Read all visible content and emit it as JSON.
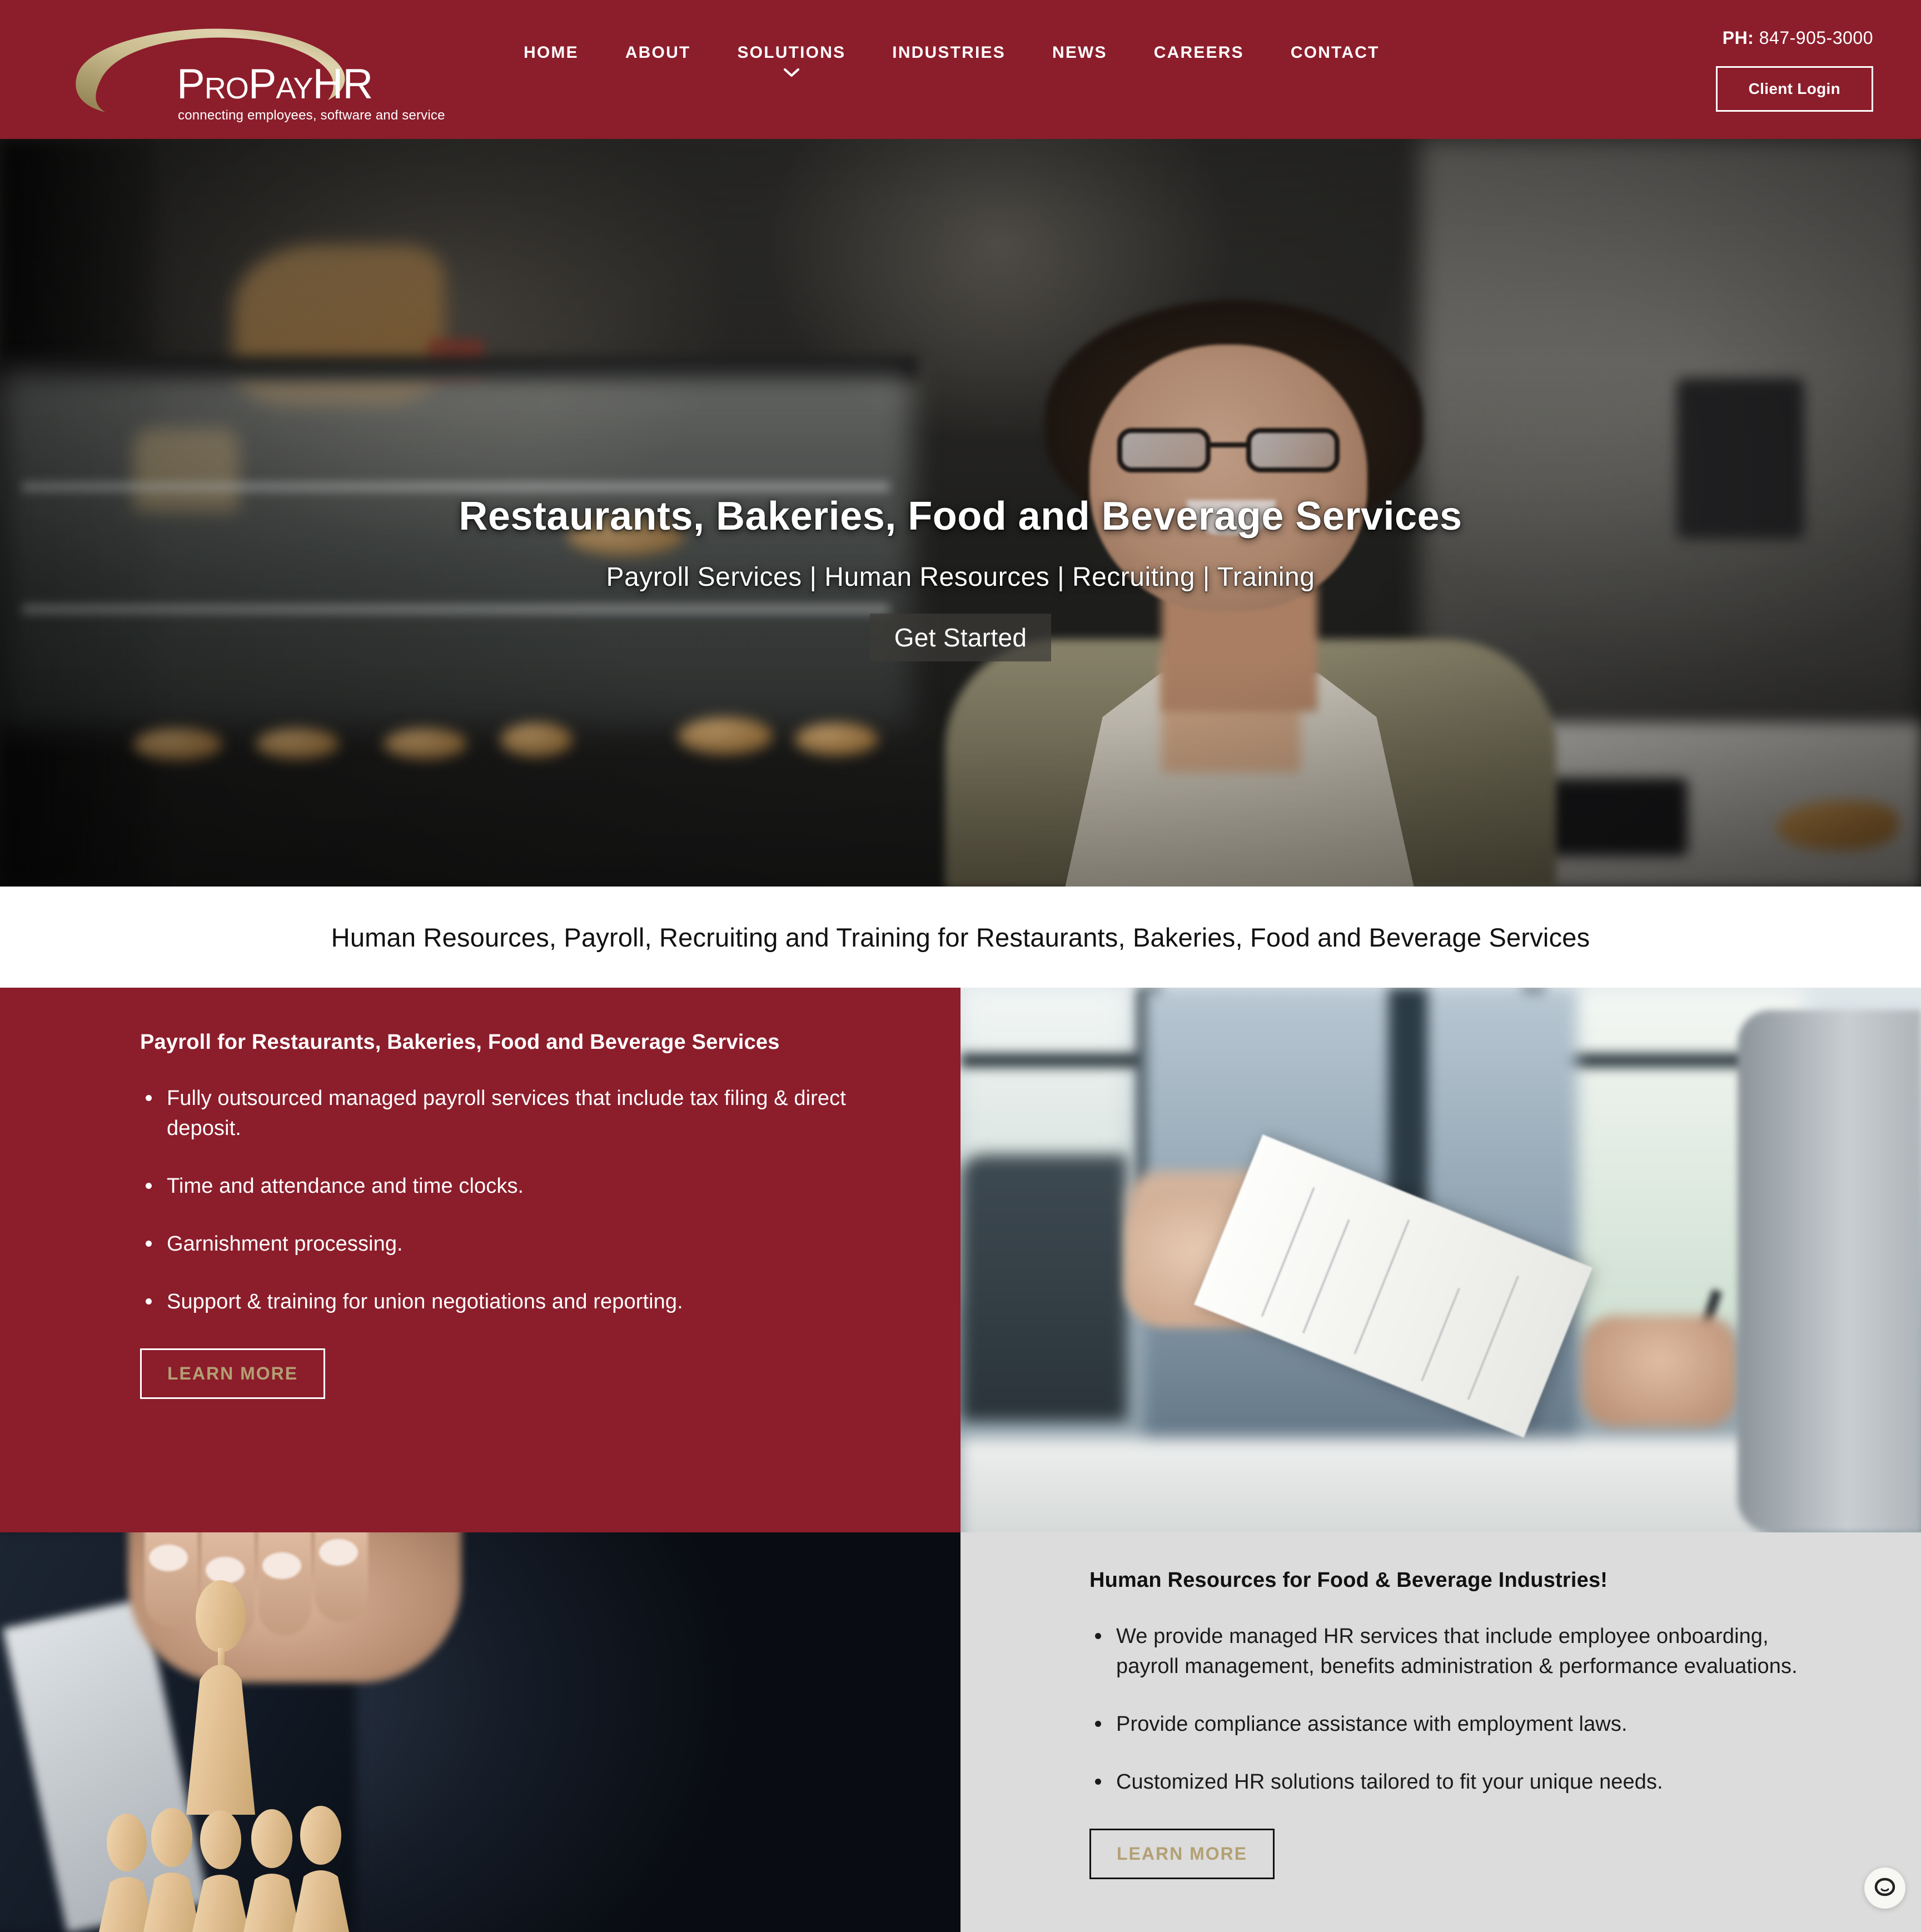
{
  "brand": {
    "logo_name": "ProPayHR",
    "logo_pro": "P",
    "logo_ro": "RO",
    "logo_p2": "P",
    "logo_ay": "AY",
    "logo_hr": "HR",
    "tagline": "connecting employees, software and service",
    "primary_color": "#8C1D2B",
    "accent_gold": "#B3A074",
    "panel_gray": "#DCDCDC"
  },
  "header": {
    "nav": [
      {
        "label": "HOME",
        "has_dropdown": false
      },
      {
        "label": "ABOUT",
        "has_dropdown": false
      },
      {
        "label": "SOLUTIONS",
        "has_dropdown": true
      },
      {
        "label": "INDUSTRIES",
        "has_dropdown": false
      },
      {
        "label": "NEWS",
        "has_dropdown": false
      },
      {
        "label": "CAREERS",
        "has_dropdown": false
      },
      {
        "label": "CONTACT",
        "has_dropdown": false
      }
    ],
    "phone_label": "PH:",
    "phone_number": "847-905-3000",
    "client_login_label": "Client Login"
  },
  "hero": {
    "title": "Restaurants, Bakeries, Food and Beverage Services",
    "subtitle": "Payroll Services | Human Resources | Recruiting | Training",
    "cta_label": "Get Started"
  },
  "intro": {
    "heading": "Human Resources, Payroll, Recruiting and Training for Restaurants, Bakeries, Food and Beverage Services"
  },
  "payroll_panel": {
    "title": "Payroll for Restaurants, Bakeries, Food and Beverage Services",
    "bullets": [
      "Fully outsourced managed payroll services that include tax filing & direct deposit.",
      "Time and attendance and time clocks.",
      "Garnishment processing.",
      "Support & training for union negotiations and reporting."
    ],
    "cta_label": "LEARN MORE"
  },
  "hr_panel": {
    "title": "Human Resources for Food & Beverage Industries!",
    "bullets": [
      "We provide managed HR services that include employee onboarding, payroll management, benefits administration & performance evaluations.",
      "Provide compliance assistance with employment laws.",
      "Customized HR solutions tailored to fit your unique needs."
    ],
    "cta_label": "LEARN MORE"
  },
  "widgets": {
    "chat_icon": "chat-bubble-icon"
  }
}
